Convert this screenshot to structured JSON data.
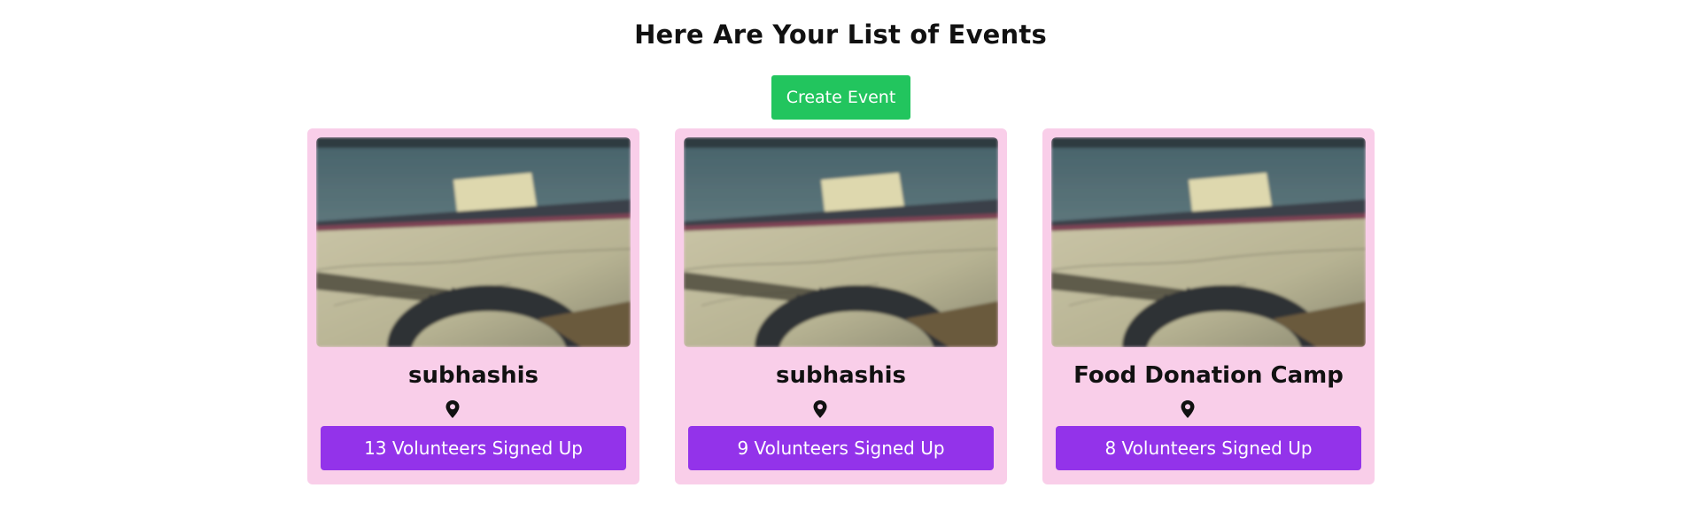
{
  "header": {
    "title": "Here Are Your List of Events",
    "create_label": "Create Event"
  },
  "colors": {
    "create_button": "#22c55e",
    "card_background": "#f9cee9",
    "volunteer_button": "#9333ea"
  },
  "events": [
    {
      "title": "subhashis",
      "location_icon": "map-pin-icon",
      "volunteers_label": "13 Volunteers Signed Up"
    },
    {
      "title": "subhashis",
      "location_icon": "map-pin-icon",
      "volunteers_label": "9 Volunteers Signed Up"
    },
    {
      "title": "Food Donation Camp",
      "location_icon": "map-pin-icon",
      "volunteers_label": "8 Volunteers Signed Up"
    }
  ]
}
